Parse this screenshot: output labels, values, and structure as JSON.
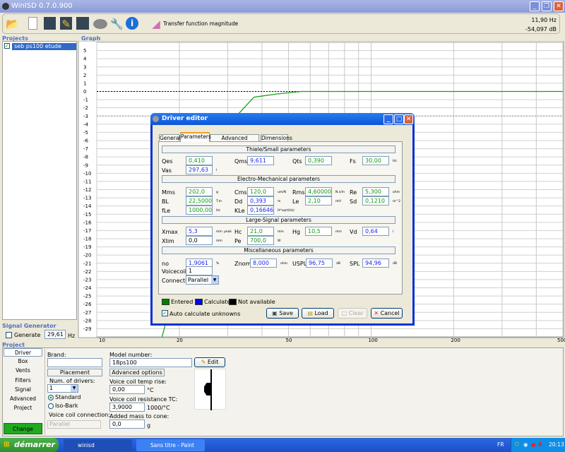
{
  "window": {
    "title": "WinISD 0.7.0.900",
    "minimize": "_",
    "restore": "❐",
    "close": "✕"
  },
  "toolbar": {
    "graph_type": "Transfer function magnitude",
    "icons": [
      "open-folder-icon",
      "new-icon",
      "save-icon",
      "save-as-icon",
      "save-all-icon",
      "driver-icon",
      "tools-icon",
      "info-icon",
      "chart-icon"
    ],
    "cursor_freq": "11,90 Hz",
    "cursor_level": "-54,097 dB"
  },
  "projects": {
    "title": "Projects",
    "items": [
      {
        "label": "seb ps100 etude",
        "checked": true
      }
    ]
  },
  "graph": {
    "title": "Graph"
  },
  "signal": {
    "title": "Signal Generator",
    "generate_label": "Generate",
    "freq": "29,61",
    "unit": "Hz"
  },
  "project": {
    "title": "Project",
    "nav": [
      "Driver",
      "Box",
      "Vents",
      "Filters",
      "Signal",
      "Advanced",
      "Project"
    ],
    "change": "Change",
    "brand_label": "Brand:",
    "brand": "",
    "placement": "Placement",
    "num_drivers_label": "Num. of drivers:",
    "num_drivers": "1",
    "standard": "Standard",
    "isobarik": "Iso-Bark",
    "vc_conn_label": "Voice coil connection:",
    "vc_conn": "Parallel",
    "model_label": "Model number:",
    "model": "18ps100",
    "edit": "Edit",
    "advanced_options": "Advanced options",
    "temp_rise_label": "Voice coil temp rise:",
    "temp_rise": "0,00",
    "temp_unit": "°C",
    "res_tc_label": "Voice coil resistance TC:",
    "res_tc": "3,9000",
    "res_tc_unit": "1000/°C",
    "added_mass_label": "Added mass to cone:",
    "added_mass": "0,0",
    "added_mass_unit": "g"
  },
  "dialog": {
    "title": "Driver editor",
    "tabs": [
      "General",
      "Parameters",
      "Advanced parameters",
      "Dimensions"
    ],
    "active_tab": "Parameters",
    "sections": [
      "Thiele/Small parameters",
      "Electro-Mechanical parameters",
      "Large-Signal parameters",
      "Miscellaneous parameters"
    ],
    "params": {
      "Qes": {
        "value": "0,410",
        "unit": "",
        "state": "entered"
      },
      "Qms": {
        "value": "9,611",
        "unit": "",
        "state": "calculated"
      },
      "Qts": {
        "value": "0,390",
        "unit": "",
        "state": "entered"
      },
      "Fs": {
        "value": "30,00",
        "unit": "Hz",
        "state": "entered"
      },
      "Vas": {
        "value": "297,63",
        "unit": "l",
        "state": "calculated"
      },
      "Mms": {
        "value": "202,0",
        "unit": "g",
        "state": "entered"
      },
      "Cms": {
        "value": "120,0",
        "unit": "um/N",
        "state": "entered"
      },
      "Rms": {
        "value": "4,60000",
        "unit": "N.s/m",
        "state": "entered"
      },
      "Re": {
        "value": "5,300",
        "unit": "ohm",
        "state": "entered"
      },
      "BL": {
        "value": "22,50000",
        "unit": "T.m",
        "state": "entered"
      },
      "Dd": {
        "value": "0,393",
        "unit": "m",
        "state": "calculated"
      },
      "Le": {
        "value": "2,10",
        "unit": "mH",
        "state": "entered"
      },
      "Sd": {
        "value": "0,1210",
        "unit": "m^2",
        "state": "entered"
      },
      "fLe": {
        "value": "1000,00",
        "unit": "Hz",
        "state": "entered"
      },
      "KLe": {
        "value": "0,166460",
        "unit": "H*sqrt(Hz)",
        "state": "calculated"
      },
      "Xmax": {
        "value": "5,3",
        "unit": "mm",
        "extra": "peak",
        "state": "calculated"
      },
      "Hc": {
        "value": "21,0",
        "unit": "mm",
        "state": "entered"
      },
      "Hg": {
        "value": "10,5",
        "unit": "mm",
        "state": "entered"
      },
      "Vd": {
        "value": "0,64",
        "unit": "l",
        "state": "calculated"
      },
      "Xlim": {
        "value": "0,0",
        "unit": "mm",
        "state": "not_available"
      },
      "Pe": {
        "value": "700,0",
        "unit": "W",
        "state": "entered"
      },
      "no": {
        "value": "1,9061",
        "unit": "%",
        "state": "calculated"
      },
      "Znom": {
        "value": "8,000",
        "unit": "ohm",
        "state": "calculated"
      },
      "USPL": {
        "value": "96,75",
        "unit": "dB",
        "state": "calculated"
      },
      "SPL": {
        "value": "94,96",
        "unit": "dB",
        "state": "calculated"
      },
      "Voicecoils": {
        "value": "1"
      },
      "Connection": {
        "value": "Parallel"
      }
    },
    "legend": [
      {
        "label": "Entered",
        "color": "#008000"
      },
      {
        "label": "Calculated",
        "color": "#0000ff"
      },
      {
        "label": "Not available",
        "color": "#000000"
      }
    ],
    "auto_calc": "Auto calculate unknowns",
    "save": "Save",
    "load": "Load",
    "clear": "Clear",
    "cancel": "Cancel"
  },
  "colors": {
    "entered": "#119911",
    "calculated": "#2222ee",
    "curve": "#1aa01a",
    "titlebar": "#0a5fd8"
  },
  "chart_data": {
    "type": "line",
    "x_scale": "log",
    "xlim": [
      10,
      500
    ],
    "ylim": [
      -30,
      6
    ],
    "grid": true,
    "x_ticks": [
      "10",
      "20",
      "50",
      "100",
      "200",
      "500"
    ],
    "x_tick_values": [
      10,
      20,
      50,
      100,
      200,
      500
    ],
    "x_grid": [
      10,
      20,
      30,
      40,
      50,
      60,
      70,
      80,
      90,
      100,
      200,
      300,
      400,
      500
    ],
    "y_ticks": [
      5,
      4,
      3,
      2,
      1,
      0,
      -1,
      -2,
      -3,
      -4,
      -5,
      -6,
      -7,
      -8,
      -9,
      -10,
      -11,
      -12,
      -13,
      -14,
      -15,
      -16,
      -17,
      -18,
      -19,
      -20,
      -21,
      -22,
      -23,
      -24,
      -25,
      -26,
      -27,
      -28,
      -29
    ],
    "reference_lines": [
      0,
      -3
    ],
    "series": [
      {
        "color": "#1aa01a",
        "x": [
          17.3,
          20,
          24,
          28,
          32.3,
          37.4,
          45.5,
          55.6,
          100,
          500
        ],
        "y": [
          -30,
          -22,
          -14,
          -7.5,
          -3,
          -0.7,
          -0.3,
          0,
          0,
          0
        ]
      }
    ]
  },
  "taskbar": {
    "start": "démarrer",
    "tasks": [
      "winisd",
      "Sans titre - Paint"
    ],
    "lang": "FR",
    "time": "20:13"
  }
}
